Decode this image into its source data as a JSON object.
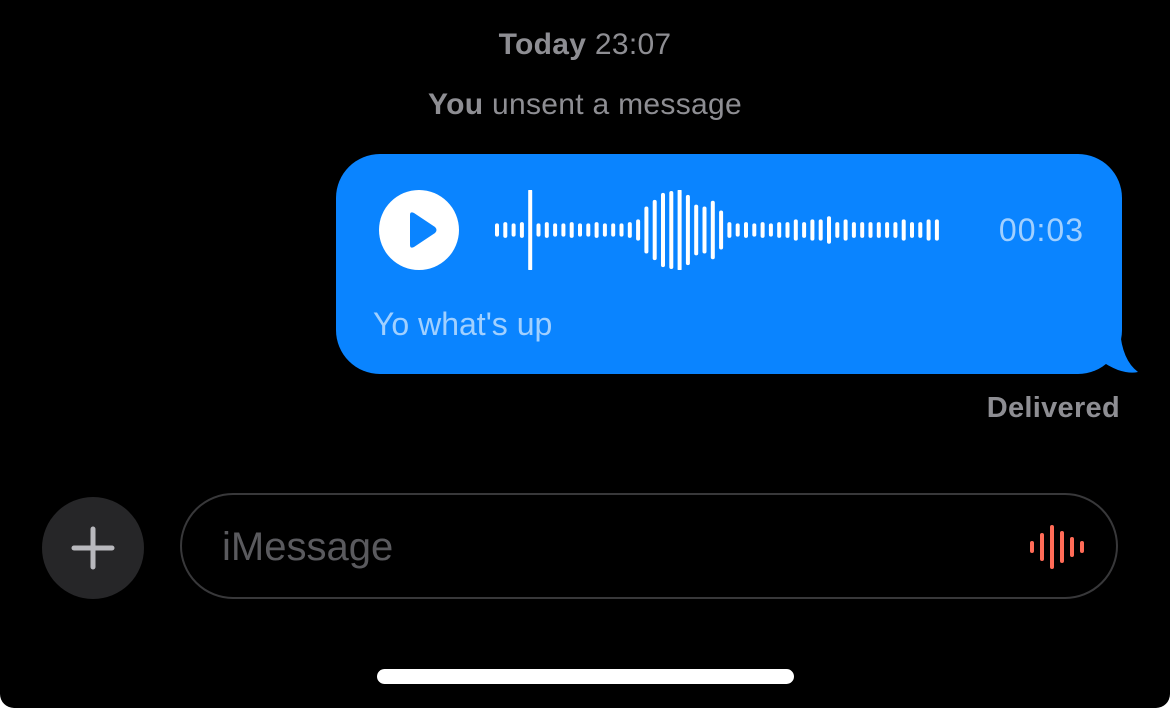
{
  "header": {
    "day": "Today",
    "time": "23:07"
  },
  "system_note": {
    "actor": "You",
    "action": "unsent a message"
  },
  "audio_message": {
    "duration": "00:03",
    "transcript": "Yo what's up",
    "bubble_color": "#0a84ff",
    "waveform_levels": [
      0.12,
      0.15,
      0.12,
      0.15,
      1.0,
      0.12,
      0.15,
      0.12,
      0.12,
      0.15,
      0.12,
      0.12,
      0.15,
      0.12,
      0.12,
      0.12,
      0.15,
      0.22,
      0.55,
      0.72,
      0.9,
      0.95,
      1.0,
      0.85,
      0.6,
      0.55,
      0.7,
      0.45,
      0.15,
      0.12,
      0.15,
      0.12,
      0.15,
      0.12,
      0.15,
      0.15,
      0.22,
      0.15,
      0.22,
      0.22,
      0.3,
      0.15,
      0.22,
      0.15,
      0.15,
      0.15,
      0.15,
      0.15,
      0.15,
      0.22,
      0.15,
      0.15,
      0.22,
      0.22
    ],
    "status": "Delivered"
  },
  "composer": {
    "add_icon": "plus-icon",
    "placeholder": "iMessage",
    "mic_icon": "waveform-icon",
    "mic_color": "#ff6b57"
  },
  "colors": {
    "background": "#000000",
    "secondary_text": "#8e8e93"
  }
}
